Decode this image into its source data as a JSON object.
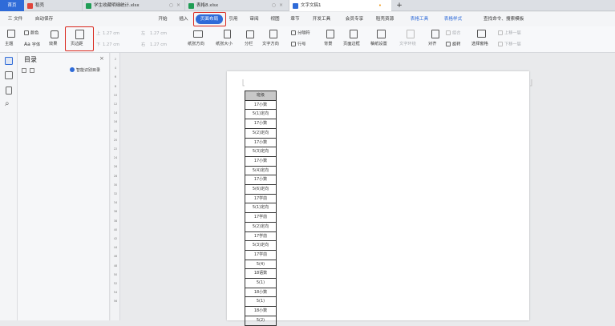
{
  "tabs": [
    {
      "label": "首页"
    },
    {
      "label": "稻壳"
    },
    {
      "label": "学生收藏明细统计.xlsx"
    },
    {
      "label": "表格8.xlsx"
    },
    {
      "label": "文字文稿1"
    }
  ],
  "tab_add": "+",
  "menu": {
    "file": "三 文件",
    "autosave": "自动保存",
    "items": [
      "开始",
      "插入",
      "页面布局",
      "引用",
      "审阅",
      "视图",
      "章节",
      "开发工具",
      "会员专享",
      "稻壳资源",
      "表格工具",
      "表格样式"
    ],
    "search": "查找命令、搜索模板"
  },
  "toolbar": {
    "theme": "主题",
    "colors": "颜色",
    "fonts": "字体",
    "effects": "效果",
    "margins": "页边距",
    "up": "上",
    "down": "下",
    "left": "左",
    "right": "右",
    "margin_values": [
      "1.27 cm",
      "1.27 cm",
      "1.27 cm",
      "1.27 cm"
    ],
    "orientation": "纸张方向",
    "size": "纸张大小",
    "columns": "分栏",
    "direction": "文字方向",
    "breaks": "分隔符",
    "line_numbers": "行号",
    "background": "背景",
    "page_border": "页面边框",
    "draft_setting": "稿纸设置",
    "wrap": "文字环绕",
    "align": "对齐",
    "rotate": "旋转",
    "selection_pane": "选择窗格",
    "group": "组合",
    "bring_up": "上移一层",
    "send_down": "下移一层"
  },
  "toc": {
    "title": "目录",
    "smart": "智能识别目录"
  },
  "ruler_marks": [
    "2",
    "4",
    "6",
    "8",
    "10",
    "12",
    "14",
    "16",
    "18",
    "20",
    "22",
    "24",
    "26",
    "28",
    "30",
    "32",
    "34",
    "36",
    "38",
    "40",
    "42",
    "44",
    "46",
    "48",
    "50",
    "52",
    "54",
    "56"
  ],
  "table": {
    "header": "班级",
    "rows": [
      "17小数",
      "5(1)定向",
      "17小数",
      "5(2)定向",
      "17小数",
      "5(3)定向",
      "17小数",
      "5(4)定向",
      "17小数",
      "5(6)定向",
      "17学前",
      "5(1)定向",
      "17学前",
      "5(2)定向",
      "17学前",
      "5(3)定向",
      "17学前",
      "5(4)",
      "18语数",
      "5(1)",
      "18小数",
      "5(1)",
      "18小数",
      "5(2)"
    ]
  },
  "colors": {
    "accent_blue": "#2f6bd8",
    "highlight_red": "#d9261c"
  }
}
